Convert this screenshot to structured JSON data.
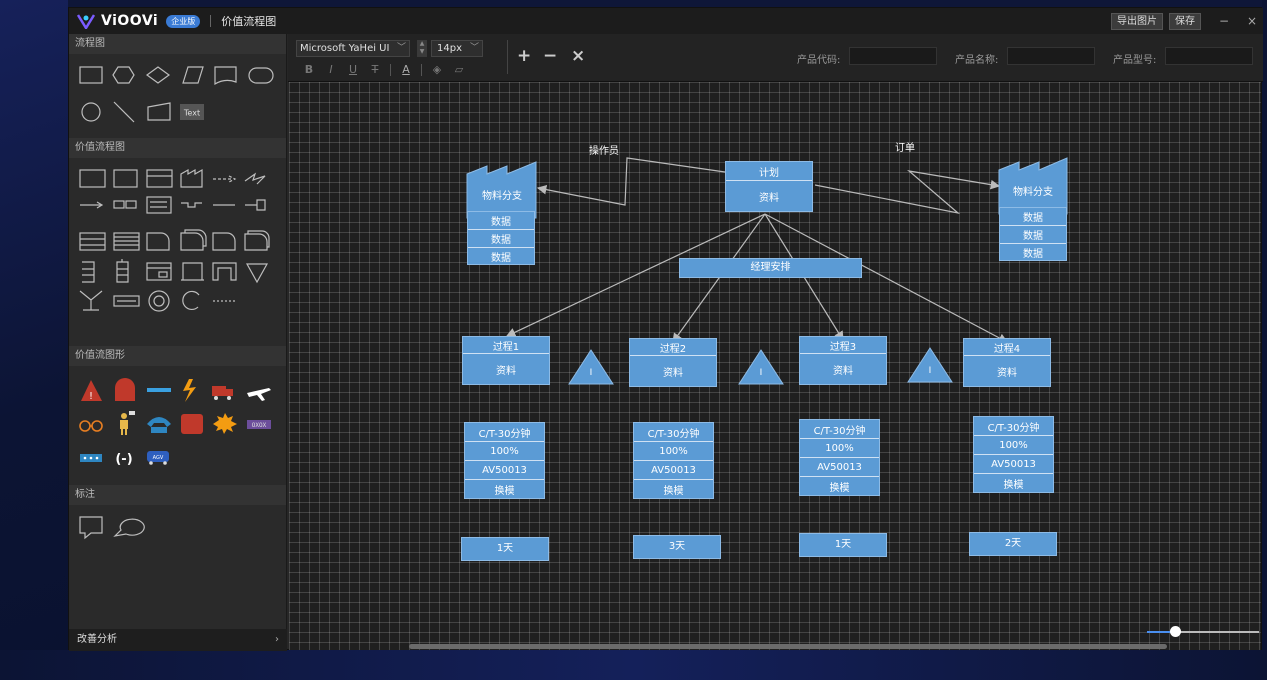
{
  "app": {
    "brand": "ViOOVi",
    "edition": "企业版",
    "doc_title": "价值流程图",
    "export_label": "导出图片",
    "save_label": "保存",
    "minimize": "−",
    "close": "×"
  },
  "sidebar": {
    "sections": [
      "流程图",
      "价值流程图",
      "价值流图形",
      "标注"
    ],
    "text_shape_label": "Text",
    "bottom_label": "改善分析",
    "bottom_chevron": "›"
  },
  "toolbar": {
    "font": "Microsoft YaHei UI",
    "size": "14px",
    "format_buttons": [
      "B",
      "I",
      "U",
      "T",
      "A"
    ],
    "zoom_in": "+",
    "zoom_out": "−",
    "clear": "×",
    "fields": [
      {
        "label": "产品代码:",
        "value": ""
      },
      {
        "label": "产品名称:",
        "value": ""
      },
      {
        "label": "产品型号:",
        "value": ""
      }
    ]
  },
  "canvas": {
    "operator_label": "操作员",
    "order_label": "订单",
    "plan": {
      "title": "计划",
      "info": "资料"
    },
    "manager": "经理安排",
    "supplier": {
      "title": "物料分支",
      "rows": [
        "数据",
        "数据",
        "数据"
      ]
    },
    "customer": {
      "title": "物料分支",
      "rows": [
        "数据",
        "数据",
        "数据"
      ]
    },
    "inventory_mark": "I",
    "processes": [
      {
        "title": "过程1",
        "info": "资料",
        "ct": "C/T-30分钟",
        "rate": "100%",
        "av": "AV50013",
        "co": "换模",
        "time": "1天"
      },
      {
        "title": "过程2",
        "info": "资料",
        "ct": "C/T-30分钟",
        "rate": "100%",
        "av": "AV50013",
        "co": "换模",
        "time": "3天"
      },
      {
        "title": "过程3",
        "info": "资料",
        "ct": "C/T-30分钟",
        "rate": "100%",
        "av": "AV50013",
        "co": "换模",
        "time": "1天"
      },
      {
        "title": "过程4",
        "info": "资料",
        "ct": "C/T-30分钟",
        "rate": "100%",
        "av": "AV50013",
        "co": "换模",
        "time": "2天"
      }
    ],
    "zoom_level": 0.25
  },
  "colors": {
    "accent": "#3a7bd5",
    "box_fill": "#5b9bd5",
    "danger": "#c0392b",
    "canvas_bg": "#1f1f1f"
  }
}
